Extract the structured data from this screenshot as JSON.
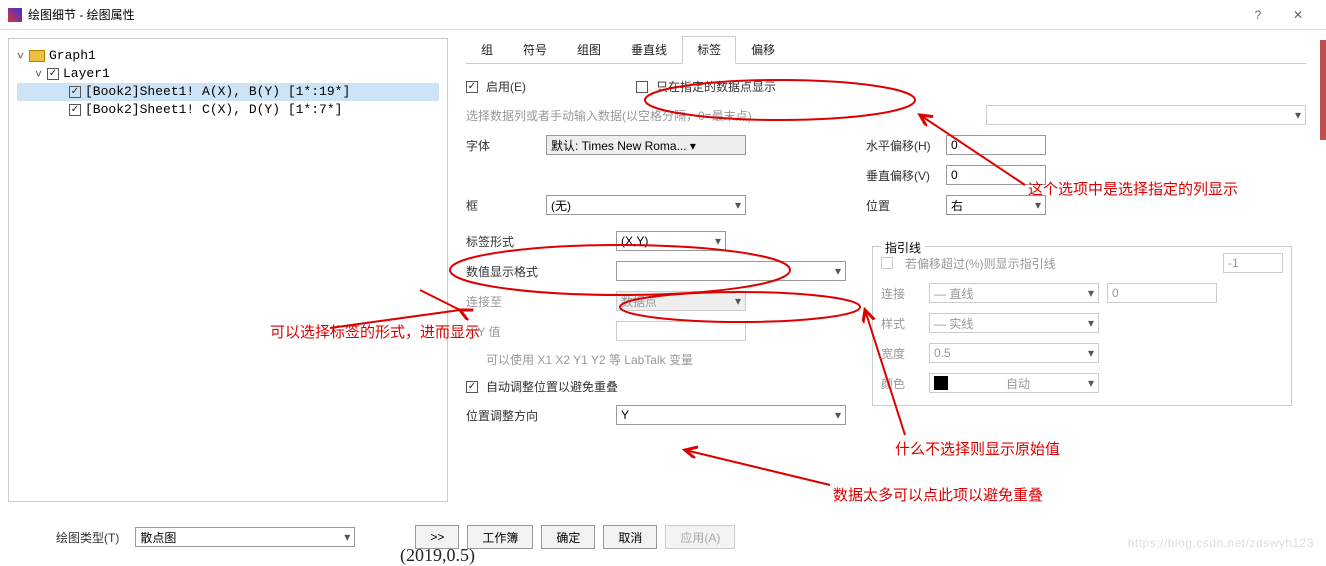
{
  "window": {
    "title": "绘图细节 - 绘图属性",
    "help": "?",
    "close": "✕"
  },
  "tree": {
    "root": "Graph1",
    "layer": "Layer1",
    "items": [
      "[Book2]Sheet1! A(X), B(Y) [1*:19*]",
      "[Book2]Sheet1! C(X), D(Y) [1*:7*]"
    ]
  },
  "tabs": [
    "组",
    "符号",
    "组图",
    "垂直线",
    "标签",
    "偏移"
  ],
  "active_tab": "标签",
  "form": {
    "enable_label": "启用(E)",
    "only_show_label": "只在指定的数据点显示",
    "select_col_hint": "选择数据列或者手动输入数据(以空格分隔，0=最末点)",
    "font_label": "字体",
    "font_value": "默认: Times New Roma... ▾",
    "box_label": "框",
    "box_value": "(无)",
    "hoffset_label": "水平偏移(H)",
    "hoffset_value": "0",
    "voffset_label": "垂直偏移(V)",
    "voffset_value": "0",
    "position_label": "位置",
    "position_value": "右",
    "labelform_label": "标签形式",
    "labelform_value": "(X,Y)",
    "numfmt_label": "数值显示格式",
    "numfmt_value": "",
    "connect_label": "连接至",
    "connect_value": "数据点",
    "xy_label": "X/Y 值",
    "xy_hint": "可以使用 X1 X2 Y1 Y2 等 LabTalk 变量",
    "auto_label": "自动调整位置以避免重叠",
    "dir_label": "位置调整方向",
    "dir_value": "Y"
  },
  "leader": {
    "legend": "指引线",
    "cb_label": "若偏移超过(%)则显示指引线",
    "threshold": "-1",
    "conn_label": "连接",
    "conn_value": "— 直线",
    "conn_num": "0",
    "style_label": "样式",
    "style_value": "— 实线",
    "width_label": "宽度",
    "width_value": "0.5",
    "color_label": "颜色",
    "color_value": "自动"
  },
  "footer": {
    "ptype_label": "绘图类型(T)",
    "ptype_value": "散点图",
    "more": ">>",
    "workbook": "工作簿",
    "ok": "确定",
    "cancel": "取消",
    "apply": "应用(A)"
  },
  "annotations": {
    "a1": "这个选项中是选择指定的列显示",
    "a2": "可以选择标签的形式，进而显示",
    "a3": "什么不选择则显示原始值",
    "a4": "数据太多可以点此项以避免重叠"
  },
  "page_num": "(2019,0.5)",
  "watermark": "https://blog.csdn.net/zdswyh123"
}
